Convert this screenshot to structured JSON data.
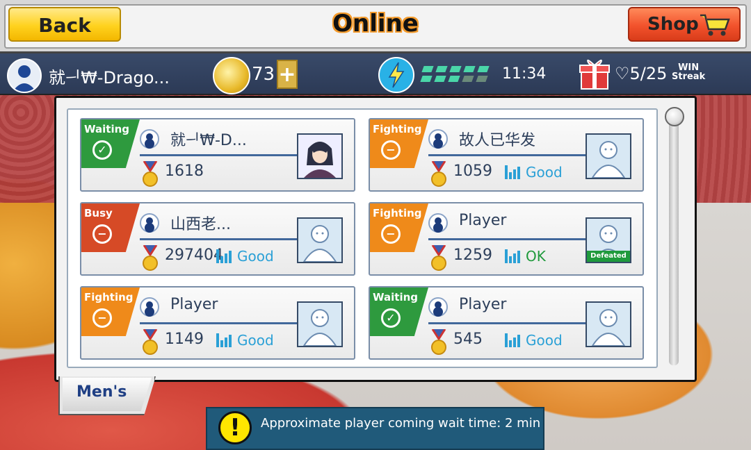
{
  "header": {
    "back_label": "Back",
    "title": "Online",
    "shop_label": "Shop"
  },
  "status": {
    "username": "就ᅴ₩-Drago...",
    "coins": "73",
    "plus_label": "+",
    "timer": "11:34",
    "win_streak": "♡5/25",
    "win_label_1": "WIN",
    "win_label_2": "Streak"
  },
  "players": [
    {
      "status": "Waiting",
      "status_color": "#2e9a3e",
      "icon": "✓",
      "name": "就ᅴ₩-D...",
      "score": "1618",
      "signal": "",
      "avatar": "anime-avatar",
      "defeated": ""
    },
    {
      "status": "Fighting",
      "status_color": "#ef8a1a",
      "icon": "−",
      "name": "故人已华发",
      "score": "1059",
      "signal": "Good",
      "avatar": "default-avatar",
      "defeated": ""
    },
    {
      "status": "Busy",
      "status_color": "#d64a26",
      "icon": "−",
      "name": "山西老...",
      "score": "297404",
      "signal": "Good",
      "avatar": "default-avatar",
      "defeated": ""
    },
    {
      "status": "Fighting",
      "status_color": "#ef8a1a",
      "icon": "−",
      "name": "Player",
      "score": "1259",
      "signal": "OK",
      "avatar": "default-avatar",
      "defeated": "Defeated"
    },
    {
      "status": "Fighting",
      "status_color": "#ef8a1a",
      "icon": "−",
      "name": "Player",
      "score": "1149",
      "signal": "Good",
      "avatar": "default-avatar",
      "defeated": ""
    },
    {
      "status": "Waiting",
      "status_color": "#2e9a3e",
      "icon": "✓",
      "name": "Player",
      "score": "545",
      "signal": "Good",
      "avatar": "default-avatar",
      "defeated": ""
    }
  ],
  "tab": {
    "label": "Men's"
  },
  "notice": {
    "icon": "!",
    "text": "Approximate player coming wait time:  2  min"
  },
  "colors": {
    "ok_signal": "#1f9a3c",
    "good_signal": "#2aa0d6"
  }
}
